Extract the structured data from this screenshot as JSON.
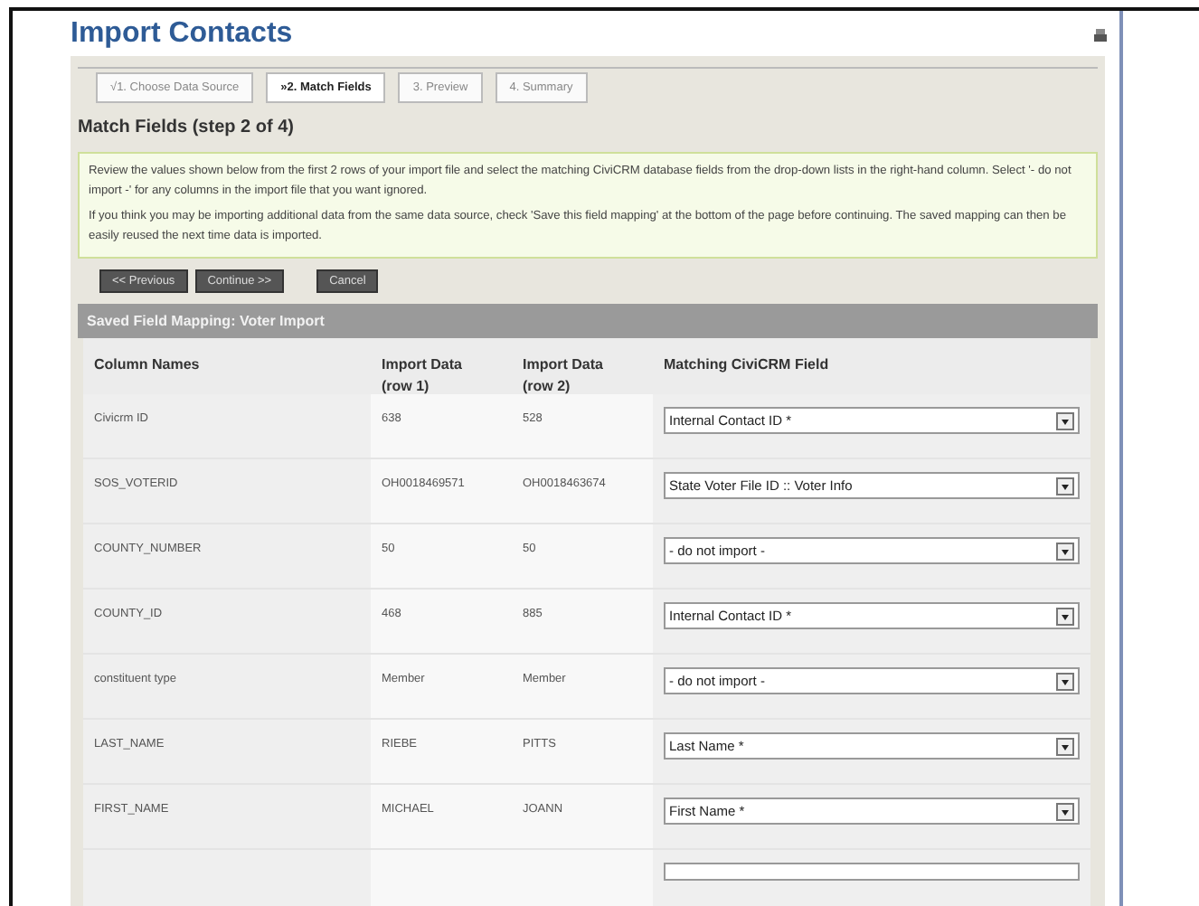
{
  "page": {
    "title": "Import Contacts"
  },
  "tabs": [
    {
      "label": "√1. Choose Data Source",
      "selected": false
    },
    {
      "label": "»2. Match Fields",
      "selected": true
    },
    {
      "label": "3. Preview",
      "selected": false
    },
    {
      "label": "4. Summary",
      "selected": false
    }
  ],
  "heading": "Match Fields (step 2 of 4)",
  "help": [
    "Review the values shown below from the first 2 rows of your import file and select the matching CiviCRM database fields from the drop-down lists in the right-hand column. Select '- do not import -' for any columns in the import file that you want ignored.",
    "If you think you may be importing additional data from the same data source, check 'Save this field mapping' at the bottom of the page before continuing. The saved mapping can then be easily reused the next time data is imported."
  ],
  "buttons": [
    "<< Previous",
    "Continue >>",
    "Cancel"
  ],
  "mapping_title": "Saved Field Mapping: Voter Import",
  "table": {
    "columns": [
      "Column Names",
      "Import Data (row 1)",
      "Import Data (row 2)",
      "Matching CiviCRM Field"
    ],
    "rows": [
      {
        "name": "Civicrm ID",
        "row1": "638",
        "row2": "528",
        "field": "Internal Contact ID *"
      },
      {
        "name": "SOS_VOTERID",
        "row1": "OH0018469571",
        "row2": "OH0018463674",
        "field": "State Voter File ID :: Voter Info"
      },
      {
        "name": "COUNTY_NUMBER",
        "row1": "50",
        "row2": "50",
        "field": "- do not import -"
      },
      {
        "name": "COUNTY_ID",
        "row1": "468",
        "row2": "885",
        "field": "Internal Contact ID *"
      },
      {
        "name": "constituent type",
        "row1": "Member",
        "row2": "Member",
        "field": "- do not import -"
      },
      {
        "name": "LAST_NAME",
        "row1": "RIEBE",
        "row2": "PITTS",
        "field": "Last Name *"
      },
      {
        "name": "FIRST_NAME",
        "row1": "MICHAEL",
        "row2": "JOANN",
        "field": "First Name *"
      }
    ]
  }
}
